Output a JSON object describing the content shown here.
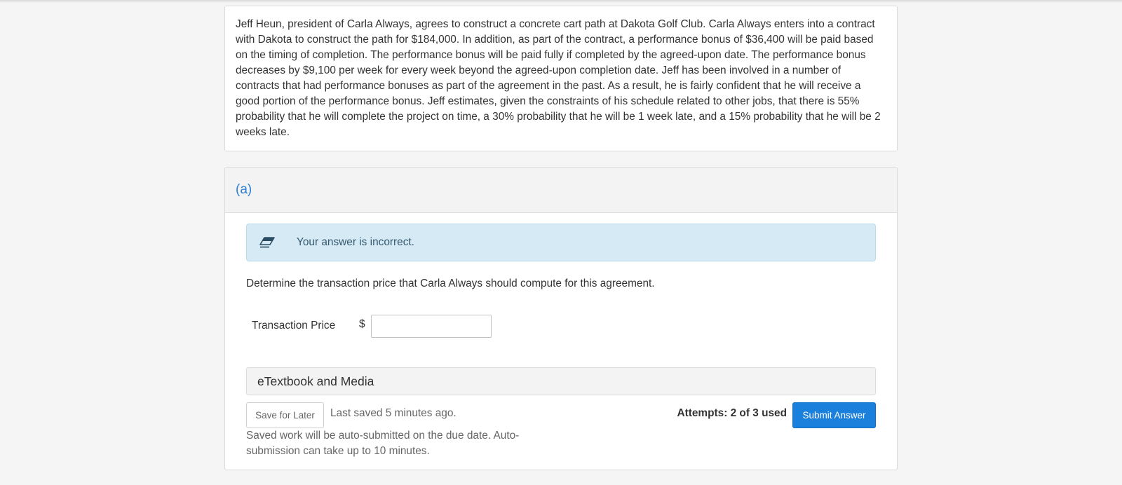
{
  "problem": {
    "text": "Jeff Heun, president of Carla Always, agrees to construct a concrete cart path at Dakota Golf Club. Carla Always enters into a contract with Dakota to construct the path for $184,000. In addition, as part of the contract, a performance bonus of $36,400 will be paid based on the timing of completion. The performance bonus will be paid fully if completed by the agreed-upon date. The performance bonus decreases by $9,100 per week for every week beyond the agreed-upon completion date. Jeff has been involved in a number of contracts that had performance bonuses as part of the agreement in the past. As a result, he is fairly confident that he will receive a good portion of the performance bonus. Jeff estimates, given the constraints of his schedule related to other jobs, that there is 55% probability that he will complete the project on time, a 30% probability that he will be 1 week late, and a 15% probability that he will be 2 weeks late."
  },
  "part": {
    "label": "(a)",
    "alert": {
      "icon": "eraser-icon",
      "text": "Your answer is incorrect.",
      "color": "#d6eaf5"
    },
    "question": "Determine the transaction price that Carla Always should compute for this agreement.",
    "field": {
      "label": "Transaction Price",
      "currency": "$",
      "value": ""
    },
    "etextbook_label": "eTextbook and Media",
    "save_label": "Save for Later",
    "last_saved": "Last saved 5 minutes ago.",
    "autosubmit_note": "Saved work will be auto-submitted on the due date. Auto-submission can take up to 10 minutes.",
    "attempts": "Attempts: 2 of 3 used",
    "submit_label": "Submit Answer"
  },
  "colors": {
    "accent": "#1b7fdc",
    "part_label": "#2d7fd3"
  }
}
